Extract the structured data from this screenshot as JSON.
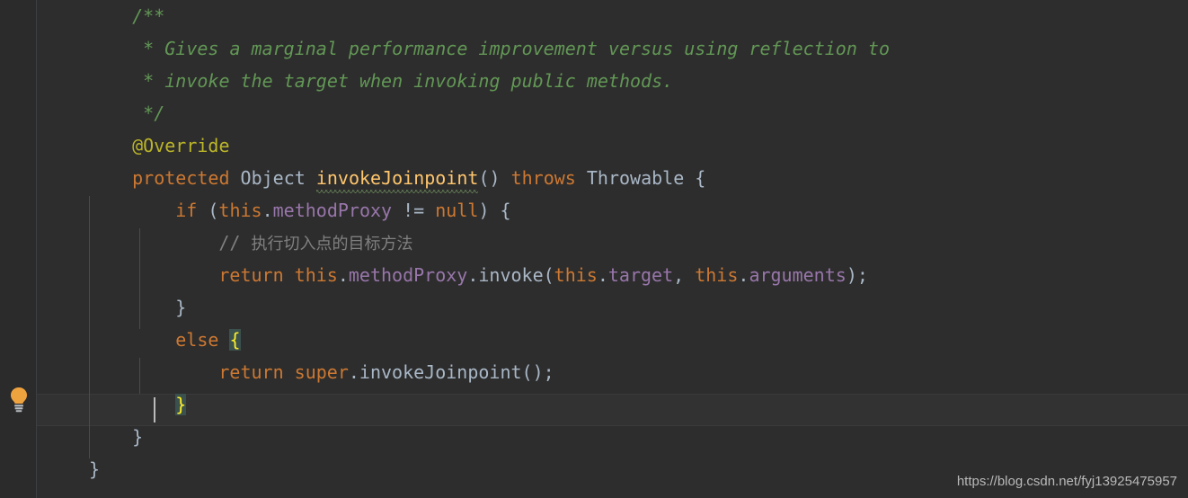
{
  "editor": {
    "theme_name": "darcula",
    "background_color": "#2d2d2d",
    "gutter_color": "#2b2b2b",
    "current_line_color": "#323232",
    "brace_match_color": "#3b514d",
    "caret_color": "#bbbbbb",
    "language": "java"
  },
  "gutter": {
    "intention_bulb_name": "lightbulb-icon"
  },
  "code": {
    "lines": [
      {
        "indent": 4,
        "tokens": [
          {
            "t": "/**",
            "c": "c-comment"
          }
        ]
      },
      {
        "indent": 4,
        "tokens": [
          {
            "t": " * Gives a marginal performance improvement versus using reflection to",
            "c": "c-comment"
          }
        ]
      },
      {
        "indent": 4,
        "tokens": [
          {
            "t": " * invoke the target when invoking public methods.",
            "c": "c-comment"
          }
        ]
      },
      {
        "indent": 4,
        "tokens": [
          {
            "t": " */",
            "c": "c-comment"
          }
        ]
      },
      {
        "indent": 4,
        "tokens": [
          {
            "t": "@Override",
            "c": "c-anno"
          }
        ]
      },
      {
        "indent": 4,
        "tokens": [
          {
            "t": "protected",
            "c": "c-keyword"
          },
          {
            "t": " ",
            "c": "c-default"
          },
          {
            "t": "Object",
            "c": "c-type"
          },
          {
            "t": " ",
            "c": "c-default"
          },
          {
            "t": "invokeJoinpoint",
            "c": "c-method",
            "squiggle": true
          },
          {
            "t": "() ",
            "c": "c-default"
          },
          {
            "t": "throws",
            "c": "c-keyword"
          },
          {
            "t": " ",
            "c": "c-default"
          },
          {
            "t": "Throwable",
            "c": "c-type"
          },
          {
            "t": " {",
            "c": "c-default"
          }
        ]
      },
      {
        "indent": 8,
        "tokens": [
          {
            "t": "if",
            "c": "c-keyword"
          },
          {
            "t": " (",
            "c": "c-default"
          },
          {
            "t": "this",
            "c": "c-keyword"
          },
          {
            "t": ".",
            "c": "c-default"
          },
          {
            "t": "methodProxy",
            "c": "c-field"
          },
          {
            "t": " != ",
            "c": "c-default"
          },
          {
            "t": "null",
            "c": "c-keyword"
          },
          {
            "t": ") {",
            "c": "c-default"
          }
        ]
      },
      {
        "indent": 12,
        "tokens": [
          {
            "t": "// ",
            "c": "c-linecmt"
          },
          {
            "t": "执行切入点的目标方法",
            "c": "c-linecmt",
            "cjk": true
          }
        ]
      },
      {
        "indent": 12,
        "tokens": [
          {
            "t": "return",
            "c": "c-keyword"
          },
          {
            "t": " ",
            "c": "c-default"
          },
          {
            "t": "this",
            "c": "c-keyword"
          },
          {
            "t": ".",
            "c": "c-default"
          },
          {
            "t": "methodProxy",
            "c": "c-field"
          },
          {
            "t": ".invoke(",
            "c": "c-default"
          },
          {
            "t": "this",
            "c": "c-keyword"
          },
          {
            "t": ".",
            "c": "c-default"
          },
          {
            "t": "target",
            "c": "c-field"
          },
          {
            "t": ", ",
            "c": "c-default"
          },
          {
            "t": "this",
            "c": "c-keyword"
          },
          {
            "t": ".",
            "c": "c-default"
          },
          {
            "t": "arguments",
            "c": "c-field"
          },
          {
            "t": ");",
            "c": "c-default"
          }
        ]
      },
      {
        "indent": 8,
        "tokens": [
          {
            "t": "}",
            "c": "c-default"
          }
        ]
      },
      {
        "indent": 8,
        "tokens": [
          {
            "t": "else",
            "c": "c-keyword"
          },
          {
            "t": " ",
            "c": "c-default"
          },
          {
            "t": "{",
            "c": "c-brace-hl"
          }
        ]
      },
      {
        "indent": 12,
        "tokens": [
          {
            "t": "return",
            "c": "c-keyword"
          },
          {
            "t": " ",
            "c": "c-default"
          },
          {
            "t": "super",
            "c": "c-keyword"
          },
          {
            "t": ".invokeJoinpoint();",
            "c": "c-default"
          }
        ]
      },
      {
        "indent": 8,
        "tokens": [
          {
            "t": "}",
            "c": "c-brace-hl"
          }
        ],
        "current": true
      },
      {
        "indent": 4,
        "tokens": [
          {
            "t": "}",
            "c": "c-default"
          }
        ]
      },
      {
        "indent": 0,
        "tokens": [
          {
            "t": "}",
            "c": "c-default"
          }
        ]
      }
    ]
  },
  "watermark": {
    "text": "https://blog.csdn.net/fyj13925475957"
  }
}
